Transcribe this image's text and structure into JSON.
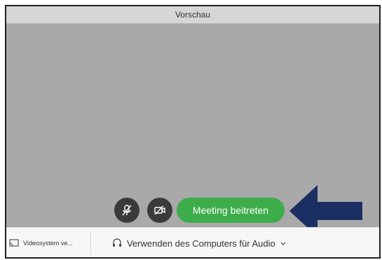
{
  "window": {
    "title": "Vorschau"
  },
  "controls": {
    "mute_icon": "microphone-muted-icon",
    "video_icon": "video-off-icon",
    "join_label": "Meeting beitreten",
    "join_color": "#3dad4b"
  },
  "footer": {
    "video_system_label": "Videosystem ve...",
    "audio_label": "Verwenden des Computers für Audio"
  },
  "annotation": {
    "arrow_color": "#1c2f62"
  }
}
